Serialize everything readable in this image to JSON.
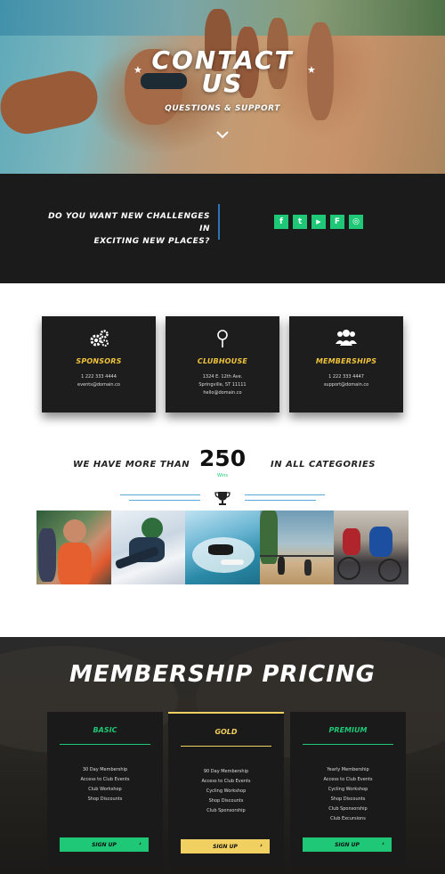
{
  "hero": {
    "title_line1": "CONTACT",
    "title_line2": "US",
    "subtitle": "QUESTIONS & SUPPORT",
    "scroll_icon": "chevron-down-icon"
  },
  "contact_bar": {
    "question_line1": "DO YOU WANT NEW CHALLENGES IN",
    "question_line2": "EXCITING NEW PLACES?",
    "socials": [
      {
        "icon": "facebook-icon",
        "glyph": "f"
      },
      {
        "icon": "twitter-icon",
        "glyph": "t"
      },
      {
        "icon": "youtube-icon",
        "glyph": "▶"
      },
      {
        "icon": "foursquare-icon",
        "glyph": "F"
      },
      {
        "icon": "instagram-icon",
        "glyph": "◎"
      }
    ],
    "accent_color": "#1ec876"
  },
  "cards": [
    {
      "title": "SPONSORS",
      "icon": "gears-icon",
      "lines": [
        "1 222 333 4444",
        "events@domain.co"
      ]
    },
    {
      "title": "CLUBHOUSE",
      "icon": "location-pin-icon",
      "lines": [
        "1324 E. 12th Ave.",
        "Springville, ST 11111",
        "hello@domain.co"
      ]
    },
    {
      "title": "MEMBERSHIPS",
      "icon": "users-icon",
      "lines": [
        "1 222 333 4447",
        "support@domain.co"
      ]
    }
  ],
  "stats": {
    "left_text": "WE HAVE MORE THAN",
    "number": "250",
    "number_label": "Wins",
    "right_text": "IN ALL CATEGORIES",
    "icon": "trophy-icon"
  },
  "gallery": [
    {
      "name": "gallery-image-runners"
    },
    {
      "name": "gallery-image-snowboarder"
    },
    {
      "name": "gallery-image-surfer"
    },
    {
      "name": "gallery-image-beach-volleyball"
    },
    {
      "name": "gallery-image-cyclists"
    }
  ],
  "pricing": {
    "title": "MEMBERSHIP PRICING",
    "plans": [
      {
        "name": "BASIC",
        "color": "#1ec876",
        "features": [
          "30 Day Membership",
          "Access to Club Events",
          "Club Workshop",
          "Shop Discounts"
        ],
        "button": "SIGN UP",
        "arrow": "›"
      },
      {
        "name": "GOLD",
        "color": "#f0d060",
        "features": [
          "90 Day Membership",
          "Access to Club Events",
          "Cycling Workshop",
          "Shop Discounts",
          "Club Sponsorship"
        ],
        "button": "SIGN UP",
        "arrow": "›"
      },
      {
        "name": "PREMIUM",
        "color": "#1ec876",
        "features": [
          "Yearly Membership",
          "Access to Club Events",
          "Cycling Workshop",
          "Shop Discounts",
          "Club Sponsorship",
          "Club Excursions"
        ],
        "button": "SIGN UP",
        "arrow": "›"
      }
    ]
  }
}
